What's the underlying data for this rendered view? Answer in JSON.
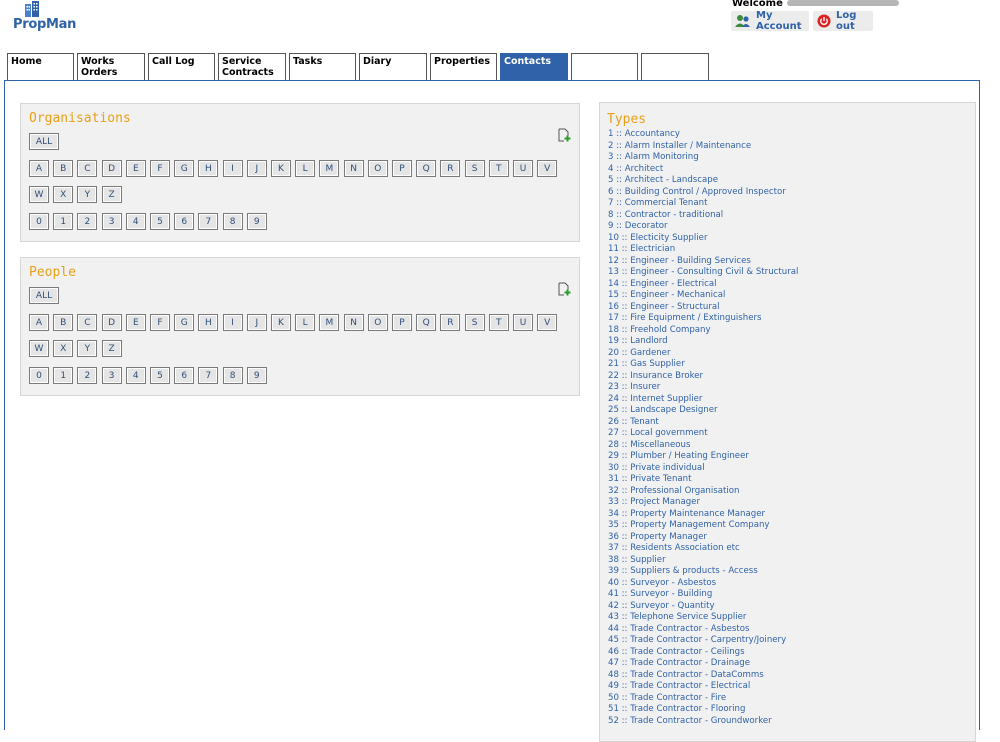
{
  "app": {
    "logo_text": "PropMan"
  },
  "account": {
    "welcome": "Welcome",
    "my_account": "My Account",
    "log_out": "Log out"
  },
  "tabs": [
    {
      "label": "Home"
    },
    {
      "label": "Works Orders"
    },
    {
      "label": "Call Log"
    },
    {
      "label": "Service Contracts"
    },
    {
      "label": "Tasks"
    },
    {
      "label": "Diary"
    },
    {
      "label": "Properties"
    },
    {
      "label": "Contacts",
      "active": true
    },
    {
      "label": ""
    },
    {
      "label": ""
    }
  ],
  "organisations": {
    "title": "Organisations",
    "all_label": "ALL"
  },
  "people": {
    "title": "People",
    "all_label": "ALL"
  },
  "letters_row1": [
    "A",
    "B",
    "C",
    "D",
    "E",
    "F",
    "G",
    "H",
    "I",
    "J",
    "K",
    "L",
    "M",
    "N",
    "O",
    "P",
    "Q",
    "R",
    "S",
    "T",
    "U",
    "V"
  ],
  "letters_row2": [
    "W",
    "X",
    "Y",
    "Z"
  ],
  "digits": [
    "0",
    "1",
    "2",
    "3",
    "4",
    "5",
    "6",
    "7",
    "8",
    "9"
  ],
  "types": {
    "title": "Types",
    "items": [
      "1 :: Accountancy",
      "2 :: Alarm Installer / Maintenance",
      "3 :: Alarm Monitoring",
      "4 :: Architect",
      "5 :: Architect - Landscape",
      "6 :: Building Control / Approved Inspector",
      "7 :: Commercial Tenant",
      "8 :: Contractor - traditional",
      "9 :: Decorator",
      "10 :: Electicity Supplier",
      "11 :: Electrician",
      "12 :: Engineer - Building Services",
      "13 :: Engineer - Consulting Civil & Structural",
      "14 :: Engineer - Electrical",
      "15 :: Engineer - Mechanical",
      "16 :: Engineer - Structural",
      "17 :: Fire Equipment / Extinguishers",
      "18 :: Freehold Company",
      "19 :: Landlord",
      "20 :: Gardener",
      "21 :: Gas Supplier",
      "22 :: Insurance Broker",
      "23 :: Insurer",
      "24 :: Internet Supplier",
      "25 :: Landscape Designer",
      "26 :: Tenant",
      "27 :: Local government",
      "28 :: Miscellaneous",
      "29 :: Plumber / Heating Engineer",
      "30 :: Private individual",
      "31 :: Private Tenant",
      "32 :: Professional Organisation",
      "33 :: Project Manager",
      "34 :: Property Maintenance Manager",
      "35 :: Property Management Company",
      "36 :: Property Manager",
      "37 :: Residents Association etc",
      "38 :: Supplier",
      "39 :: Suppliers & products - Access",
      "40 :: Surveyor - Asbestos",
      "41 :: Surveyor - Building",
      "42 :: Surveyor - Quantity",
      "43 :: Telephone Service Supplier",
      "44 :: Trade Contractor - Asbestos",
      "45 :: Trade Contractor - Carpentry/Joinery",
      "46 :: Trade Contractor - Ceilings",
      "47 :: Trade Contractor - Drainage",
      "48 :: Trade Contractor - DataComms",
      "49 :: Trade Contractor - Electrical",
      "50 :: Trade Contractor - Fire",
      "51 :: Trade Contractor - Flooring",
      "52 :: Trade Contractor - Groundworker"
    ]
  },
  "colors": {
    "brand": "#2f62a8",
    "accent": "#e8a019",
    "panel_bg": "#f1f1f1"
  }
}
